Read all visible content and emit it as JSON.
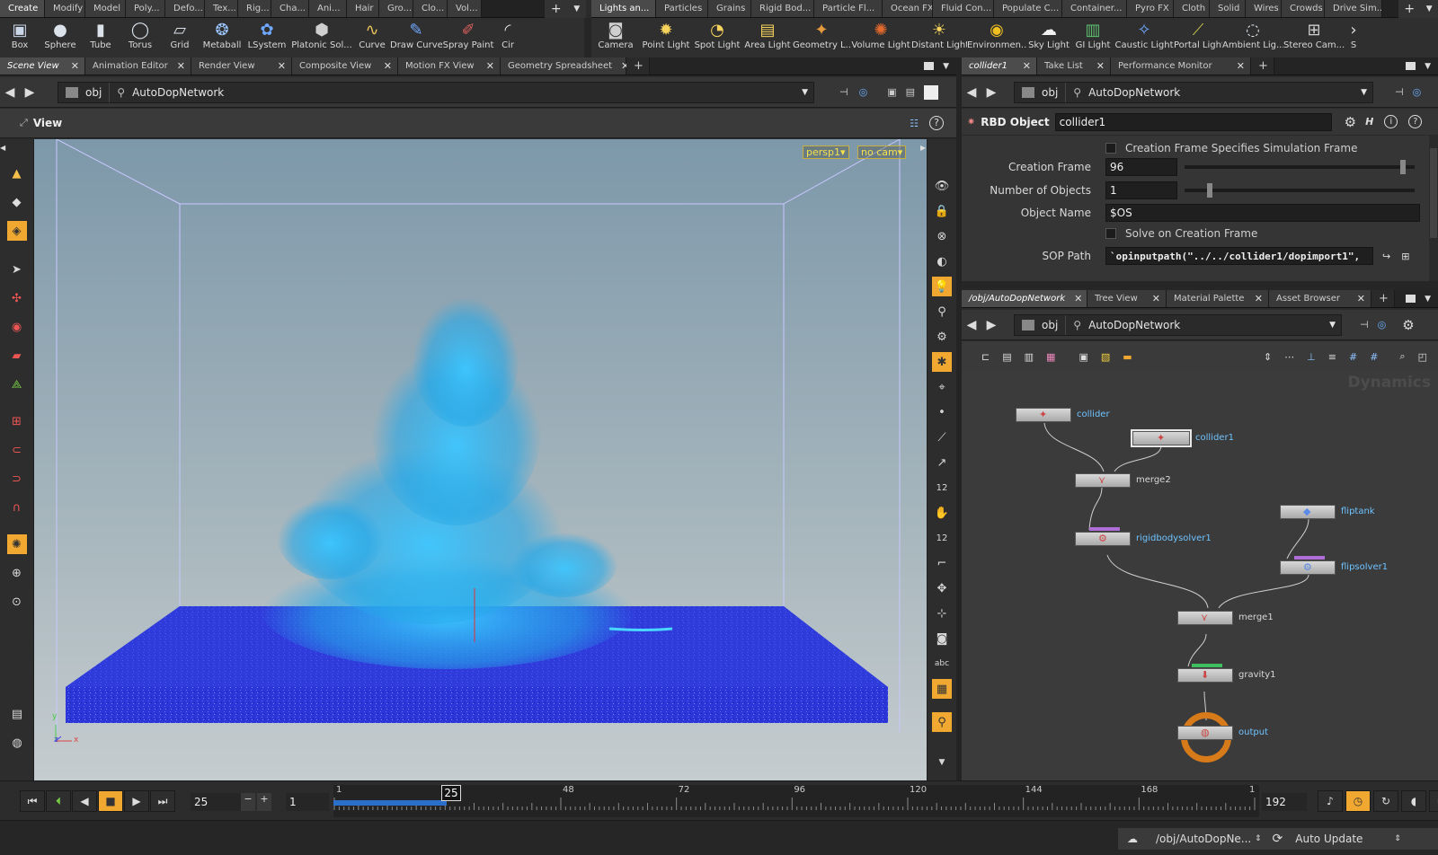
{
  "shelf_left_tabs": [
    {
      "label": "Create",
      "selected": true
    },
    {
      "label": "Modify"
    },
    {
      "label": "Model"
    },
    {
      "label": "Poly..."
    },
    {
      "label": "Defo..."
    },
    {
      "label": "Tex..."
    },
    {
      "label": "Rig..."
    },
    {
      "label": "Cha..."
    },
    {
      "label": "Ani..."
    },
    {
      "label": "Hair"
    },
    {
      "label": "Gro..."
    },
    {
      "label": "Clo..."
    },
    {
      "label": "Vol..."
    }
  ],
  "shelf_left_tools": [
    {
      "label": "Box",
      "icon": "box-icon"
    },
    {
      "label": "Sphere",
      "icon": "sphere-icon"
    },
    {
      "label": "Tube",
      "icon": "tube-icon"
    },
    {
      "label": "Torus",
      "icon": "torus-icon"
    },
    {
      "label": "Grid",
      "icon": "grid-icon"
    },
    {
      "label": "Metaball",
      "icon": "metaball-icon"
    },
    {
      "label": "LSystem",
      "icon": "lsystem-icon"
    },
    {
      "label": "Platonic Sol...",
      "icon": "platonic-icon"
    },
    {
      "label": "Curve",
      "icon": "curve-icon"
    },
    {
      "label": "Draw Curve",
      "icon": "draw-curve-icon"
    },
    {
      "label": "Spray Paint",
      "icon": "spray-paint-icon"
    },
    {
      "label": "Cir",
      "icon": "circle-icon"
    }
  ],
  "shelf_right_tabs": [
    {
      "label": "Lights an...",
      "selected": true
    },
    {
      "label": "Particles"
    },
    {
      "label": "Grains"
    },
    {
      "label": "Rigid Bod..."
    },
    {
      "label": "Particle Fl..."
    },
    {
      "label": "Ocean FX"
    },
    {
      "label": "Fluid Con..."
    },
    {
      "label": "Populate C..."
    },
    {
      "label": "Container..."
    },
    {
      "label": "Pyro FX"
    },
    {
      "label": "Cloth"
    },
    {
      "label": "Solid"
    },
    {
      "label": "Wires"
    },
    {
      "label": "Crowds"
    },
    {
      "label": "Drive Sim..."
    }
  ],
  "shelf_right_tools": [
    {
      "label": "Camera",
      "icon": "camera-icon"
    },
    {
      "label": "Point Light",
      "icon": "point-light-icon"
    },
    {
      "label": "Spot Light",
      "icon": "spot-light-icon"
    },
    {
      "label": "Area Light",
      "icon": "area-light-icon"
    },
    {
      "label": "Geometry L...",
      "icon": "geometry-light-icon"
    },
    {
      "label": "Volume Light",
      "icon": "volume-light-icon"
    },
    {
      "label": "Distant Light",
      "icon": "distant-light-icon"
    },
    {
      "label": "Environmen...",
      "icon": "environment-light-icon"
    },
    {
      "label": "Sky Light",
      "icon": "sky-light-icon"
    },
    {
      "label": "GI Light",
      "icon": "gi-light-icon"
    },
    {
      "label": "Caustic Light",
      "icon": "caustic-light-icon"
    },
    {
      "label": "Portal Light",
      "icon": "portal-light-icon"
    },
    {
      "label": "Ambient Lig...",
      "icon": "ambient-light-icon"
    },
    {
      "label": "Stereo Cam...",
      "icon": "stereo-camera-icon"
    },
    {
      "label": "S",
      "icon": "more-icon"
    }
  ],
  "left_pane_tabs": [
    {
      "label": "Scene View",
      "selected": true
    },
    {
      "label": "Animation Editor"
    },
    {
      "label": "Render View"
    },
    {
      "label": "Composite View"
    },
    {
      "label": "Motion FX View"
    },
    {
      "label": "Geometry Spreadsheet"
    }
  ],
  "left_path": {
    "root": "obj",
    "node": "AutoDopNetwork"
  },
  "viewport": {
    "title": "View",
    "camera": "persp1▾",
    "cam_mode": "no cam▾",
    "axis_y": "y",
    "axis_z": "z",
    "axis_x": "x"
  },
  "right_top_tabs": [
    {
      "label": "collider1",
      "selected": true
    },
    {
      "label": "Take List"
    },
    {
      "label": "Performance Monitor"
    }
  ],
  "right_top_path": {
    "root": "obj",
    "node": "AutoDopNetwork"
  },
  "parms": {
    "type_label": "RBD Object",
    "node_name": "collider1",
    "creation_frame_specifies": "Creation Frame Specifies Simulation Frame",
    "creation_frame_label": "Creation Frame",
    "creation_frame_value": "96",
    "creation_frame_slider": 0.96,
    "num_objects_label": "Number of Objects",
    "num_objects_value": "1",
    "num_objects_slider": 0.1,
    "object_name_label": "Object Name",
    "object_name_value": "$OS",
    "solve_on_creation": "Solve on Creation Frame",
    "sop_path_label": "SOP Path",
    "sop_path_value": "`opinputpath(\"../../collider1/dopimport1\","
  },
  "right_bottom_tabs": [
    {
      "label": "/obj/AutoDopNetwork",
      "selected": true
    },
    {
      "label": "Tree View"
    },
    {
      "label": "Material Palette"
    },
    {
      "label": "Asset Browser"
    }
  ],
  "right_bottom_path": {
    "root": "obj",
    "node": "AutoDopNetwork"
  },
  "network": {
    "watermark": "Dynamics",
    "nodes": [
      {
        "name": "collider"
      },
      {
        "name": "collider1"
      },
      {
        "name": "merge2"
      },
      {
        "name": "rigidbodysolver1"
      },
      {
        "name": "fliptank"
      },
      {
        "name": "flipsolver1"
      },
      {
        "name": "merge1"
      },
      {
        "name": "gravity1"
      },
      {
        "name": "output"
      }
    ]
  },
  "timeline": {
    "current_frame": "25",
    "step": "1",
    "start": "1",
    "end_field": "192",
    "cursor_label": "25",
    "ticks": [
      "1",
      "48",
      "72",
      "96",
      "120",
      "144",
      "168",
      "1"
    ]
  },
  "statusbar": {
    "path": "/obj/AutoDopNe...",
    "update_mode": "Auto Update"
  },
  "colors": {
    "accent": "#f0a830",
    "node_label": "#6fc3ff",
    "selection_orange": "#d77a1a",
    "timeline_blue": "#2a6fc9"
  }
}
